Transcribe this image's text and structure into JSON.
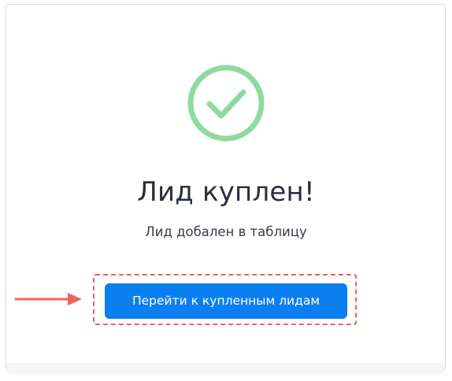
{
  "dialog": {
    "title": "Лид куплен!",
    "subtitle": "Лид добален в таблицу",
    "action_label": "Перейти к купленным лидам"
  },
  "icons": {
    "success": "check-circle-icon",
    "pointer": "arrow-right-icon"
  },
  "colors": {
    "success_green": "#8fdb9f",
    "primary_button": "#0b7ff0",
    "annotation_red": "#f06358",
    "title_text": "#2a2e3b"
  }
}
